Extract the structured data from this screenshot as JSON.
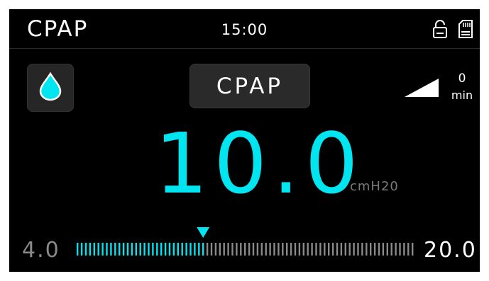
{
  "header": {
    "mode_title": "CPAP",
    "time": "15:00",
    "icons": [
      "lock-icon",
      "sd-card-icon"
    ]
  },
  "controls": {
    "humidifier_icon": "water-drop-icon",
    "mode_button_label": "CPAP",
    "ramp_icon": "ramp-triangle-icon",
    "ramp_value": "0",
    "ramp_unit": "min"
  },
  "pressure": {
    "value": "10.0",
    "unit": "cmH20"
  },
  "scale": {
    "min_label": "4.0",
    "max_label": "20.0",
    "min": 4.0,
    "max": 20.0,
    "current": 10.0,
    "active_color": "#00e5ef",
    "inactive_color": "#8a8a8a"
  }
}
